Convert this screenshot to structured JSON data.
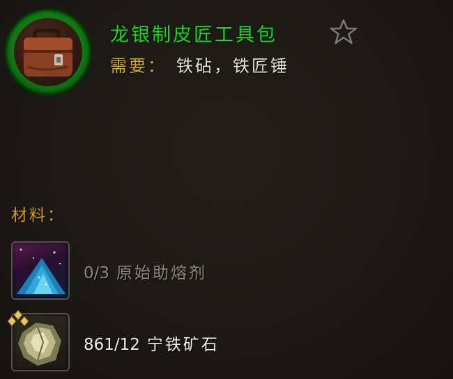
{
  "recipe": {
    "title": "龙银制皮匠工具包",
    "icon": "leather-toolkit-bag",
    "ring_color": "#1fb41a",
    "requires_label": "需要",
    "requires_colon": "：",
    "requires_value": "铁砧，铁匠锤",
    "favorite_icon": "star-outline"
  },
  "materials": {
    "heading": "材料：",
    "items": [
      {
        "icon": "primal-flux",
        "count_text": "0/3",
        "name": "原始助熔剂",
        "state": "insufficient"
      },
      {
        "icon": "serevite-ore",
        "quality_icon": "gold-diamond-quality",
        "count_text": "861/12",
        "name": "宁铁矿石",
        "state": "sufficient"
      }
    ]
  },
  "colors": {
    "title": "#1fd623",
    "requires_label": "#d7b021",
    "materials_heading": "#d79b1b",
    "insufficient": "#8f8a80",
    "sufficient": "#f2efe8"
  }
}
